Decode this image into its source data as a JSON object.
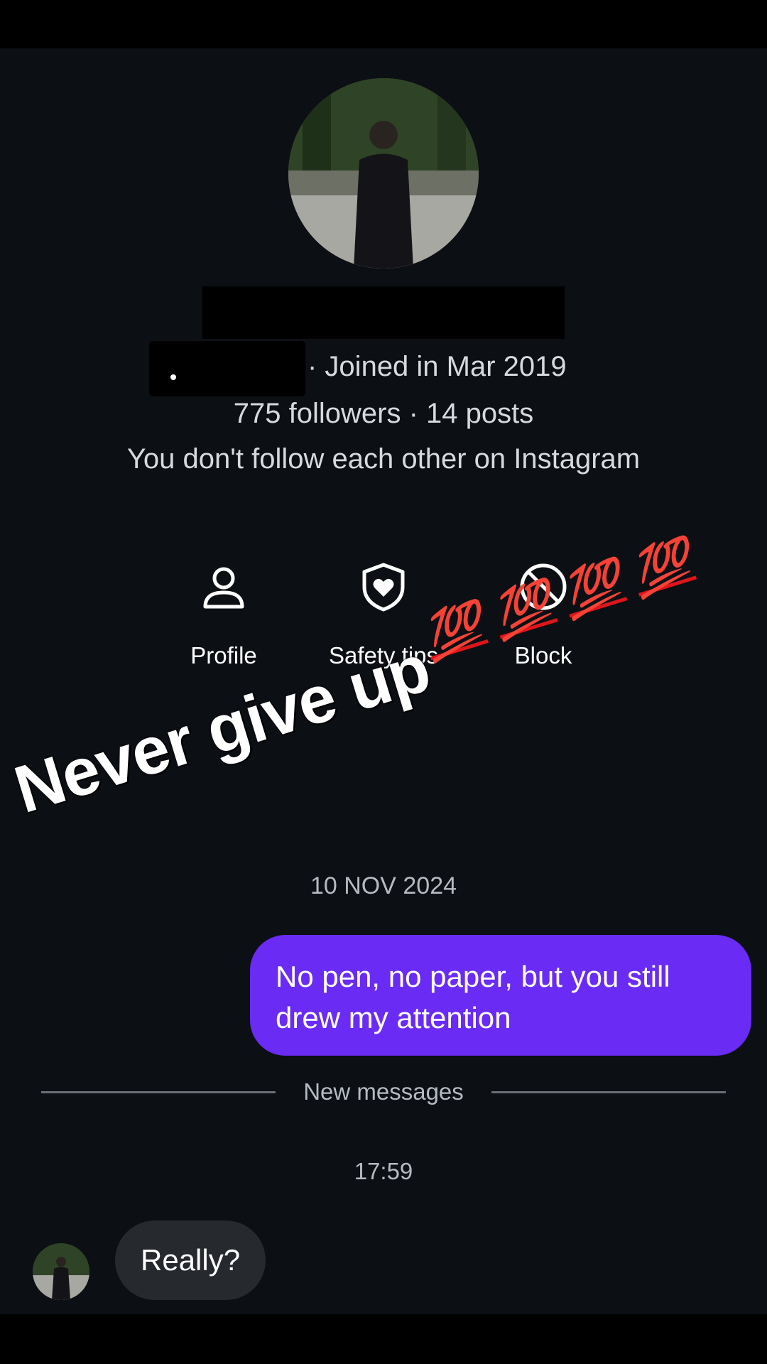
{
  "profile": {
    "joined": "· Joined in Mar 2019",
    "stats": "775 followers · 14 posts",
    "follow_note": "You don't follow each other on Instagram"
  },
  "actions": [
    {
      "label": "Profile",
      "icon": "person-icon"
    },
    {
      "label": "Safety tips",
      "icon": "shield-heart-icon"
    },
    {
      "label": "Block",
      "icon": "block-icon"
    }
  ],
  "overlay": {
    "caption": "Never give up",
    "emoji": [
      "💯",
      "💯",
      "💯",
      "💯"
    ],
    "emoji_color": "#e0151b"
  },
  "chat": {
    "date_separator": "10 NOV 2024",
    "outgoing_message": "No pen, no paper, but you still drew my attention",
    "outgoing_color": "#6a2bf5",
    "new_messages_label": "New messages",
    "timestamp": "17:59",
    "incoming_message": "Really?"
  }
}
